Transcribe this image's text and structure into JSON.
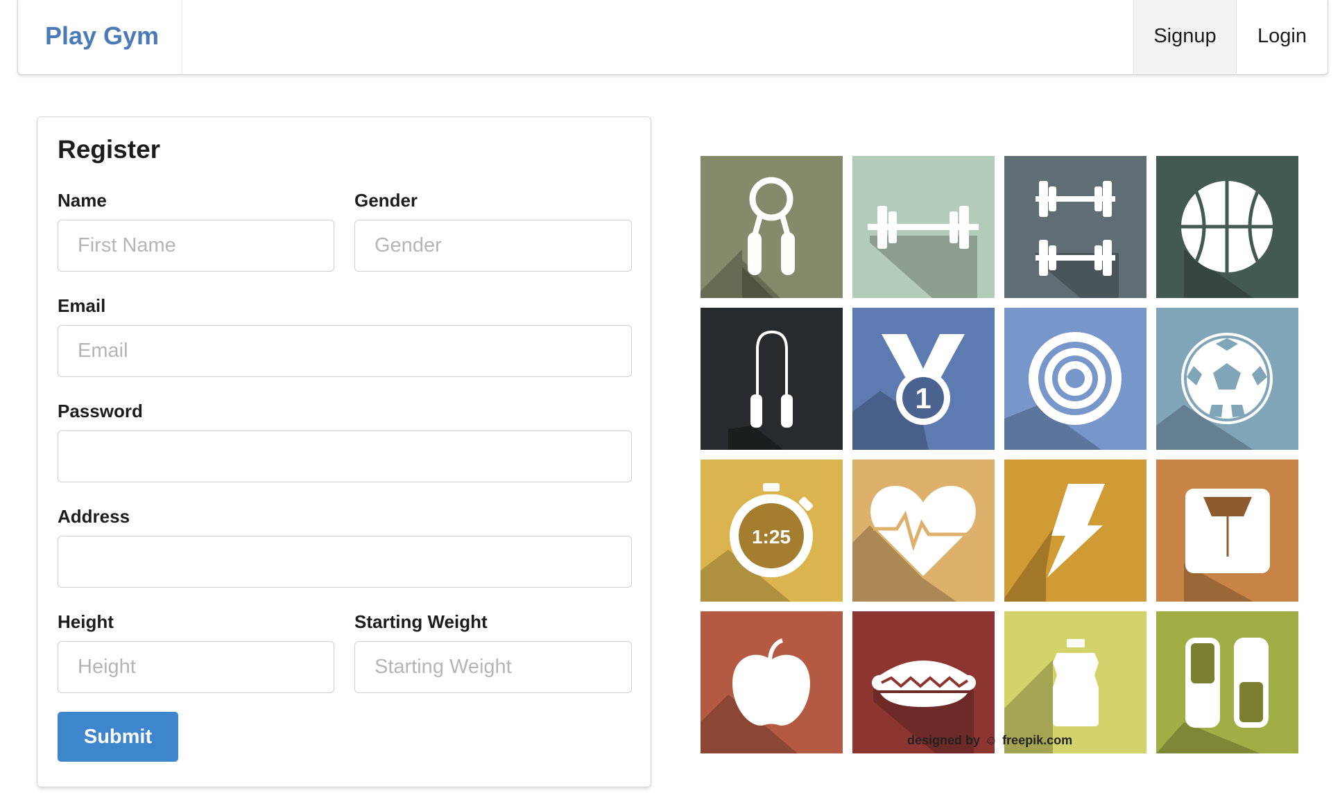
{
  "navbar": {
    "brand": "Play Gym",
    "items": [
      {
        "label": "Signup",
        "active": true
      },
      {
        "label": "Login",
        "active": false
      }
    ]
  },
  "form": {
    "title": "Register",
    "fields": {
      "name": {
        "label": "Name",
        "placeholder": "First Name",
        "value": ""
      },
      "gender": {
        "label": "Gender",
        "placeholder": "Gender",
        "value": ""
      },
      "email": {
        "label": "Email",
        "placeholder": "Email",
        "value": ""
      },
      "password": {
        "label": "Password",
        "placeholder": "",
        "value": ""
      },
      "address": {
        "label": "Address",
        "placeholder": "",
        "value": ""
      },
      "height": {
        "label": "Height",
        "placeholder": "Height",
        "value": ""
      },
      "starting_weight": {
        "label": "Starting Weight",
        "placeholder": "Starting Weight",
        "value": ""
      }
    },
    "submit_label": "Submit"
  },
  "illustration": {
    "tiles": [
      {
        "icon": "hand-grip-icon",
        "color": "#858a6b"
      },
      {
        "icon": "barbell-icon",
        "color": "#b3cbb9"
      },
      {
        "icon": "dumbbells-icon",
        "color": "#5f6d74"
      },
      {
        "icon": "basketball-icon",
        "color": "#435a50"
      },
      {
        "icon": "jump-rope-icon",
        "color": "#272b2d"
      },
      {
        "icon": "medal-icon",
        "color": "#5d7bb0",
        "text": "1"
      },
      {
        "icon": "target-icon",
        "color": "#7796c9"
      },
      {
        "icon": "soccer-ball-icon",
        "color": "#80a5b9"
      },
      {
        "icon": "stopwatch-icon",
        "color": "#dbb44f",
        "text": "1:25"
      },
      {
        "icon": "heartbeat-icon",
        "color": "#ddb06c"
      },
      {
        "icon": "lightning-icon",
        "color": "#d09a34"
      },
      {
        "icon": "scale-icon",
        "color": "#c78446"
      },
      {
        "icon": "apple-icon",
        "color": "#b45a43"
      },
      {
        "icon": "hotdog-icon",
        "color": "#8d3631"
      },
      {
        "icon": "water-bottle-icon",
        "color": "#d2d46b"
      },
      {
        "icon": "pills-icon",
        "color": "#a1ad45"
      }
    ],
    "credit": "designed by",
    "credit_site": "freepik.com"
  }
}
